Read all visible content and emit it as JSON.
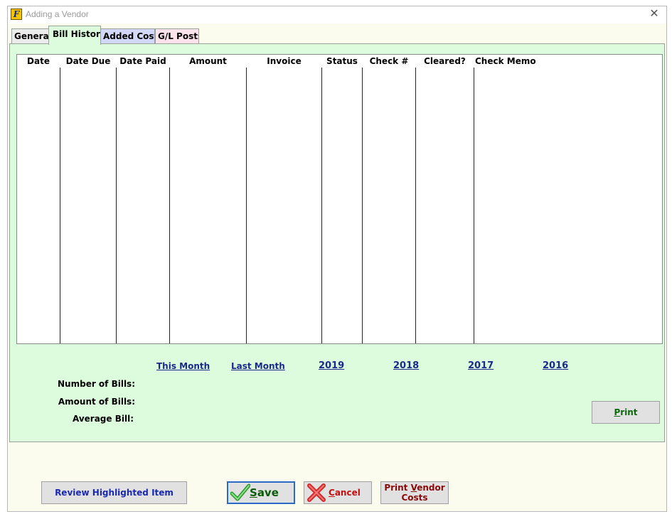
{
  "window": {
    "title": "Adding a Vendor",
    "icon": "app-logo-icon",
    "icon_glyph": "F"
  },
  "tabs": [
    {
      "label": "General",
      "active": false
    },
    {
      "label": "Bill History",
      "active": true
    },
    {
      "label": "Added Costs",
      "active": false
    },
    {
      "label": "G/L Posts",
      "active": false
    }
  ],
  "grid": {
    "columns": [
      "Date",
      "Date Due",
      "Date Paid",
      "Amount",
      "Invoice",
      "Status",
      "Check #",
      "Cleared?",
      "Check Memo"
    ],
    "rows": []
  },
  "periods": [
    "This Month",
    "Last Month",
    "2019",
    "2018",
    "2017",
    "2016"
  ],
  "stats": {
    "number_label": "Number of Bills:",
    "amount_label": "Amount of Bills:",
    "average_label": "Average Bill:"
  },
  "buttons": {
    "print_first": "P",
    "print_rest": "rint",
    "review": "Review Highlighted Item",
    "save_first": "S",
    "save_rest": "ave",
    "cancel_first": "C",
    "cancel_rest": "ancel",
    "print_vendor_a": "Print ",
    "print_vendor_u": "V",
    "print_vendor_b": "endor",
    "print_vendor_line2": "Costs"
  },
  "colors": {
    "panel_bg": "#ddfcdd",
    "window_bg": "#fcfcee",
    "link": "#1a2a8a",
    "save_border": "#2a6ac8"
  }
}
